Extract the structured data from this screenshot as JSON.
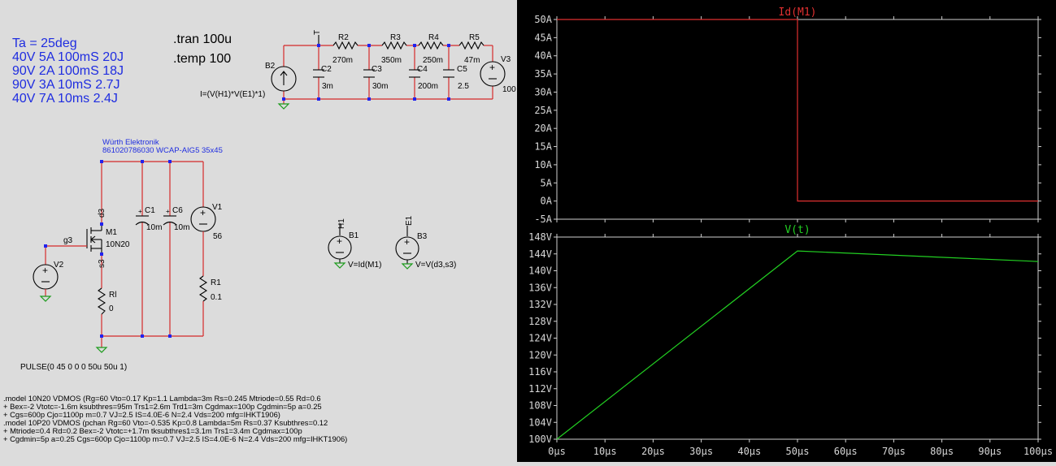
{
  "schematic": {
    "notes": [
      "Ta = 25deg",
      "40V 5A 100mS 20J",
      "90V 2A 100mS 18J",
      "90V 3A 10mS 2.7J",
      "40V 7A 10ms 2.4J"
    ],
    "directives": [
      ".tran 100u",
      ".temp 100"
    ],
    "thermal": {
      "source_name": "B2",
      "source_expr": "I=(V(H1)*V(E1)*1)",
      "node_label": "T",
      "resistors": [
        {
          "name": "R2",
          "value": "270m"
        },
        {
          "name": "R3",
          "value": "350m"
        },
        {
          "name": "R4",
          "value": "250m"
        },
        {
          "name": "R5",
          "value": "47m"
        }
      ],
      "caps": [
        {
          "name": "C2",
          "value": "3m"
        },
        {
          "name": "C3",
          "value": "30m"
        },
        {
          "name": "C4",
          "value": "200m"
        },
        {
          "name": "C5",
          "value": "2.5"
        }
      ],
      "v3_name": "V3",
      "v3_value": "100"
    },
    "cap_part": {
      "maker": "Würth Elektronik",
      "part": "861020786030 WCAP-AIG5 35x45"
    },
    "power": {
      "m1_name": "M1",
      "m1_model": "10N20",
      "d_net": "d3",
      "s_net": "s3",
      "g_net": "g3",
      "v2_name": "V2",
      "rl_name": "Rl",
      "rl_value": "0",
      "c1_name": "C1",
      "c1_value": "10m",
      "c6_name": "C6",
      "c6_value": "10m",
      "v1_name": "V1",
      "v1_value": "56",
      "r1_name": "R1",
      "r1_value": "0.1",
      "pulse": "PULSE(0 45 0 0 0 50u 50u 1)"
    },
    "bsources": {
      "b1_name": "B1",
      "b1_net": "H1",
      "b1_expr": "V=Id(M1)",
      "b3_name": "B3",
      "b3_net": "E1",
      "b3_expr": "V=V(d3,s3)"
    },
    "models": [
      ".model 10N20 VDMOS (Rg=60 Vto=0.17 Kp=1.1 Lambda=3m Rs=0.245  Mtriode=0.55 Rd=0.6",
      "+ Bex=-2 Vtotc=-1.6m ksubthres=95m Trs1=2.6m Trd1=3m Cgdmax=100p Cgdmin=5p a=0.25",
      "+ Cgs=600p Cjo=1100p m=0.7 VJ=2.5 IS=4.0E-6 N=2.4 Vds=200 mfg=IHKT1906)",
      ".model 10P20 VDMOS (pchan Rg=60 Vto=-0.535 Kp=0.8 Lambda=5m Rs=0.37 Ksubthres=0.12",
      "+ Mtriode=0.4 Rd=0.2 Bex=-2 Vtotc=+1.7m tksubthres1=3.1m Trs1=3.4m Cgdmax=100p",
      "+ Cgdmin=5p a=0.25 Cgs=600p Cjo=1100p m=0.7 VJ=2.5 IS=4.0E-6 N=2.4 Vds=200 mfg=IHKT1906)"
    ],
    "colors": {
      "wire": "#d42a2a",
      "junction": "#2222ee",
      "ground": "#1b9a1b",
      "notes": "#1f2de0"
    }
  },
  "chart_data": [
    {
      "type": "line",
      "title": "Id(M1)",
      "x": [
        "0µs",
        "10µs",
        "20µs",
        "30µs",
        "40µs",
        "50µs",
        "60µs",
        "70µs",
        "80µs",
        "90µs",
        "100µs"
      ],
      "yticks": [
        "-5A",
        "0A",
        "5A",
        "10A",
        "15A",
        "20A",
        "25A",
        "30A",
        "35A",
        "40A",
        "45A",
        "50A"
      ],
      "ylim": [
        -5,
        50
      ],
      "xlim": [
        0,
        100
      ],
      "series": [
        {
          "name": "Id(M1)",
          "color": "#e03030",
          "points": [
            [
              0,
              50
            ],
            [
              50,
              50
            ],
            [
              50,
              0
            ],
            [
              100,
              0
            ]
          ]
        }
      ],
      "grid": false
    },
    {
      "type": "line",
      "title": "V(t)",
      "x": [
        "0µs",
        "10µs",
        "20µs",
        "30µs",
        "40µs",
        "50µs",
        "60µs",
        "70µs",
        "80µs",
        "90µs",
        "100µs"
      ],
      "yticks": [
        "100V",
        "104V",
        "108V",
        "112V",
        "116V",
        "120V",
        "124V",
        "128V",
        "132V",
        "136V",
        "140V",
        "144V",
        "148V"
      ],
      "ylim": [
        100,
        148
      ],
      "xlim": [
        0,
        100
      ],
      "series": [
        {
          "name": "V(t)",
          "color": "#22d022",
          "points": [
            [
              0,
              100
            ],
            [
              50,
              144.7
            ],
            [
              100,
              142.2
            ]
          ]
        }
      ],
      "grid": false
    }
  ]
}
